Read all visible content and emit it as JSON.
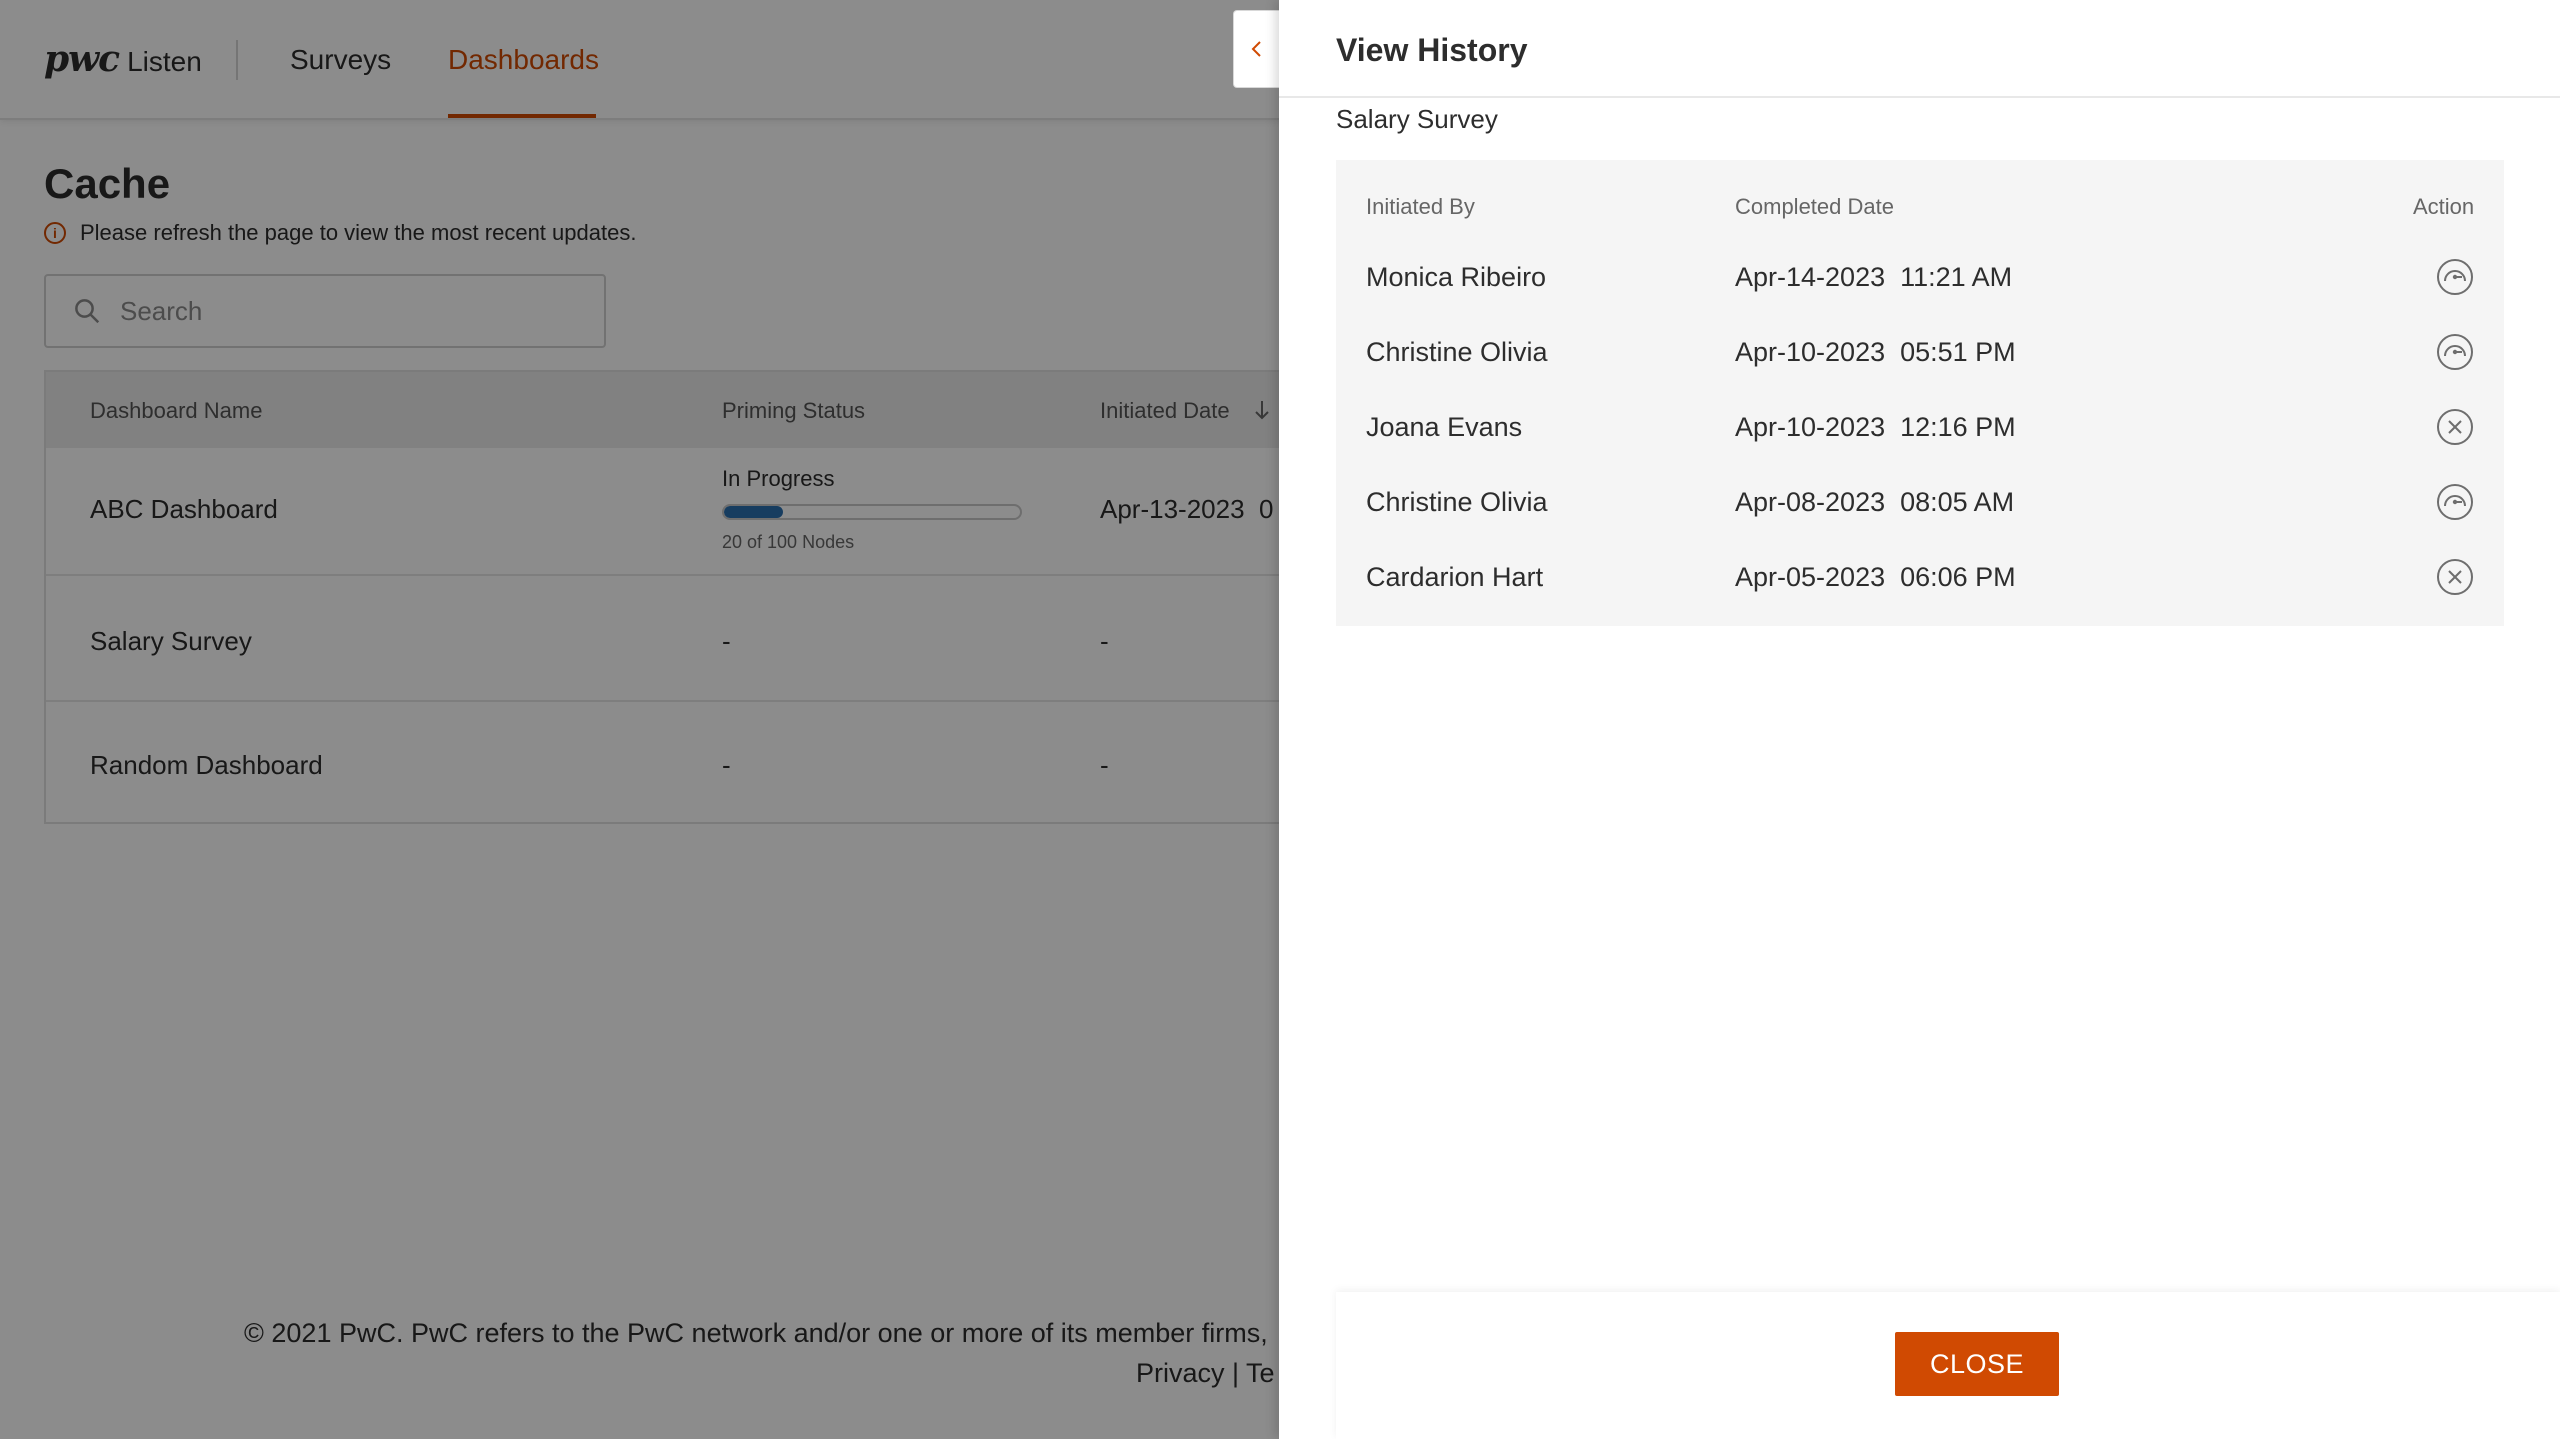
{
  "app": {
    "logo_brand": "pwc",
    "logo_product": "Listen",
    "nav": {
      "surveys": "Surveys",
      "dashboards": "Dashboards"
    },
    "accent_color": "#d04a02"
  },
  "main": {
    "title": "Cache",
    "info_text": "Please refresh the page to view the most recent updates.",
    "search_placeholder": "Search",
    "table": {
      "headers": {
        "name": "Dashboard Name",
        "status": "Priming Status",
        "initiated": "Initiated Date"
      },
      "rows": [
        {
          "name": "ABC Dashboard",
          "status_label": "In Progress",
          "progress_fraction": 0.2,
          "progress_text": "20 of 100 Nodes",
          "initiated": "Apr-13-2023  0"
        },
        {
          "name": "Salary Survey",
          "status": "-",
          "initiated": "-"
        },
        {
          "name": "Random Dashboard",
          "status": "-",
          "initiated": "-"
        }
      ]
    },
    "footer_text": "© 2021 PwC. PwC refers to the PwC network and/or one or more of its member firms,",
    "footer_links": "Privacy |  Te"
  },
  "drawer": {
    "title": "View History",
    "subtitle": "Salary Survey",
    "headers": {
      "initiated_by": "Initiated By",
      "completed": "Completed Date",
      "action": "Action"
    },
    "rows": [
      {
        "name": "Monica Ribeiro",
        "date": "Apr-14-2023  11:21 AM",
        "icon": "gauge-icon"
      },
      {
        "name": "Christine Olivia",
        "date": "Apr-10-2023  05:51 PM",
        "icon": "gauge-icon"
      },
      {
        "name": "Joana Evans",
        "date": "Apr-10-2023  12:16 PM",
        "icon": "cancel-circle-icon"
      },
      {
        "name": "Christine Olivia",
        "date": "Apr-08-2023  08:05 AM",
        "icon": "gauge-icon"
      },
      {
        "name": "Cardarion Hart",
        "date": "Apr-05-2023  06:06 PM",
        "icon": "cancel-circle-icon"
      }
    ],
    "close_label": "CLOSE"
  }
}
